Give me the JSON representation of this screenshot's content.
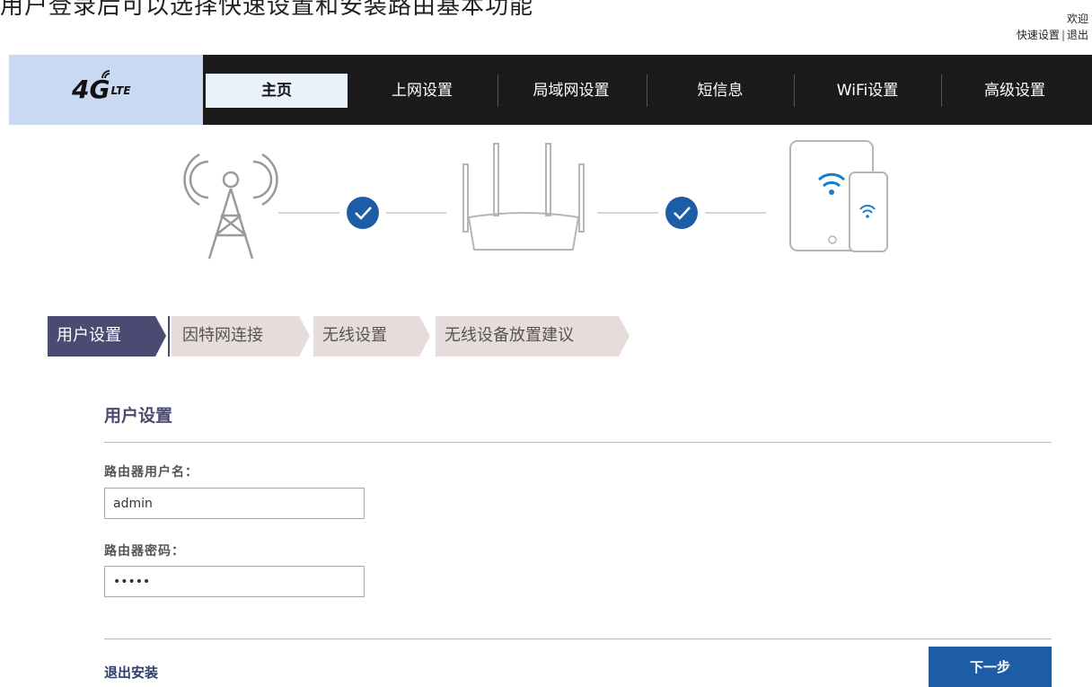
{
  "caption": "用户登录后可以选择快速设置和安装路由基本功能",
  "header": {
    "welcome": "欢迎",
    "quick_setup": "快速设置",
    "separator": "|",
    "logout": "退出"
  },
  "logo": {
    "main": "4G",
    "sub": "LTE"
  },
  "nav": {
    "items": [
      {
        "label": "主页",
        "active": true
      },
      {
        "label": "上网设置"
      },
      {
        "label": "局域网设置"
      },
      {
        "label": "短信息"
      },
      {
        "label": "WiFi设置"
      },
      {
        "label": "高级设置"
      }
    ]
  },
  "steps": [
    {
      "label": "用户设置",
      "active": true
    },
    {
      "label": "因特网连接"
    },
    {
      "label": "无线设置"
    },
    {
      "label": "无线设备放置建议"
    }
  ],
  "form": {
    "title": "用户设置",
    "username_label": "路由器用户名：",
    "username_value": "admin",
    "password_label": "路由器密码：",
    "password_value": "•••••"
  },
  "footer": {
    "exit_label": "退出安装",
    "next_label": "下一步"
  },
  "colors": {
    "accent": "#1c5da6",
    "step_active": "#4b4a73",
    "step_inactive": "#e7dcdc",
    "nav_bg": "#1b1b1b",
    "logo_bg": "#c9d9f1"
  }
}
